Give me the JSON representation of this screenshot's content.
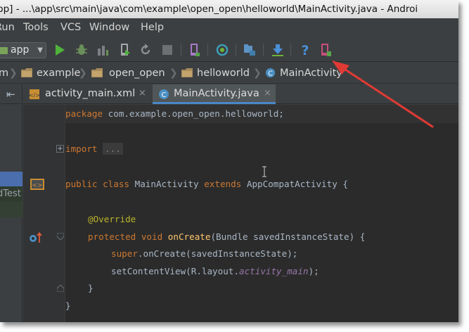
{
  "window": {
    "title": "pp] - ...\\app\\src\\main\\java\\com\\example\\open_open\\helloworld\\MainActivity.java - Androi"
  },
  "menu": {
    "run": "Run",
    "tools": "Tools",
    "vcs": "VCS",
    "window": "Window",
    "help": "Help"
  },
  "toolbar": {
    "run_configuration": "app"
  },
  "breadcrumbs": [
    "m",
    "example",
    "open_open",
    "helloworld",
    "MainActivity"
  ],
  "project_panel": {
    "test_label": "dTest"
  },
  "tabs": [
    {
      "label": "activity_main.xml",
      "close": "×"
    },
    {
      "label": "MainActivity.java",
      "close": "×"
    }
  ],
  "code": {
    "line1": {
      "kw": "package",
      "rest": " com.example.open_open.helloworld;"
    },
    "line2": {
      "kw": "import",
      "dots": "..."
    },
    "line3": {
      "kw1": "public",
      "kw2": "class",
      "name": "MainActivity",
      "kw3": "extends",
      "parent": "AppCompatActivity",
      "brace": " {"
    },
    "line4": {
      "annotation": "@Override"
    },
    "line5": {
      "kw1": "protected",
      "kw2": "void",
      "method": "onCreate",
      "params": "(Bundle savedInstanceState) {"
    },
    "line6": {
      "kw": "super",
      "rest": ".onCreate(savedInstanceState);"
    },
    "line7": {
      "call": "setContentView(R.layout.",
      "field": "activity_main",
      "end": ");"
    },
    "line8": {
      "brace": "}"
    },
    "line9": {
      "brace": "}"
    }
  },
  "colors": {
    "keyword": "#cc7832",
    "annotation": "#bbb529",
    "method": "#ffc66d",
    "field": "#9876aa",
    "text": "#a9b7c6",
    "accent_tab": "#4a88c7",
    "arrow": "#e03a35"
  },
  "icons": [
    "run-icon",
    "debug-icon",
    "attach-icon",
    "apply-icon",
    "rerun-icon",
    "stop-icon",
    "avd-icon",
    "sync-icon",
    "project-structure-icon",
    "sdk-icon",
    "help-icon",
    "device-monitor-icon"
  ]
}
